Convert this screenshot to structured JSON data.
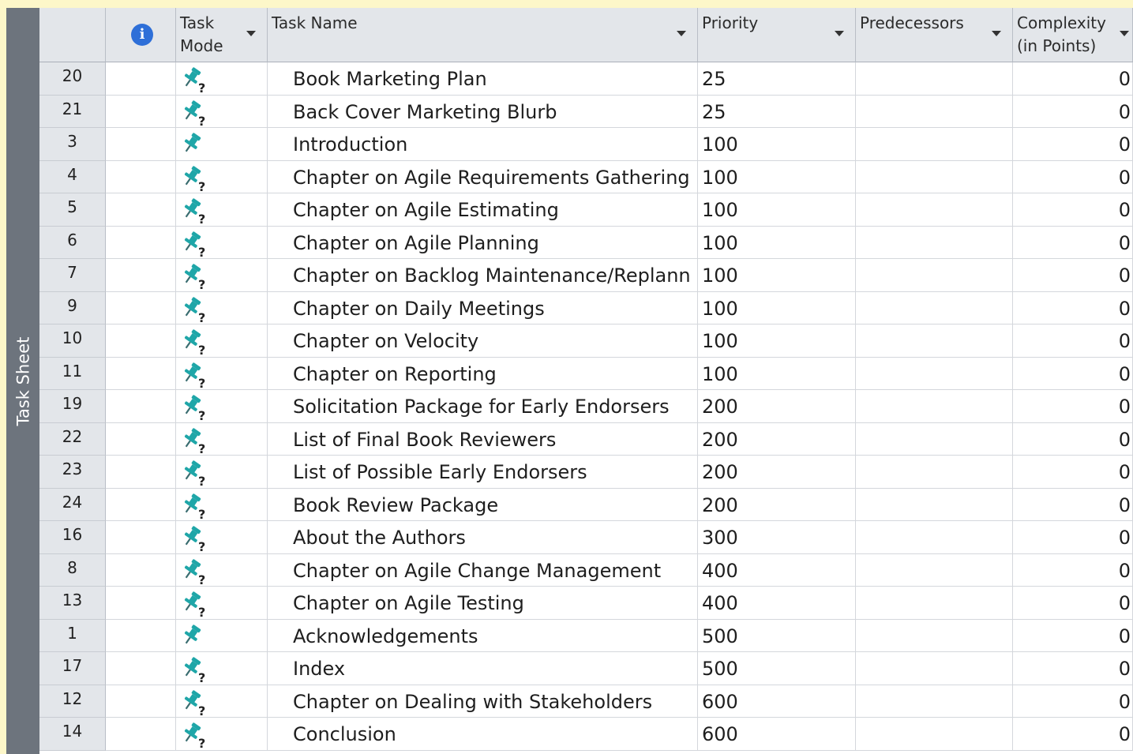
{
  "sidebar": {
    "label": "Task Sheet"
  },
  "header": {
    "info_icon": "info-icon",
    "task_mode": "Task\nMode",
    "task_name": "Task Name",
    "priority": "Priority",
    "predecessors": "Predecessors",
    "complexity": "Complexity\n(in Points)"
  },
  "colors": {
    "pin": "#1fa6a8",
    "question": "#222222",
    "header_bg": "#e3e6ea",
    "sidebar_bg": "#6d747d",
    "frame_bg": "#fdf7c9"
  },
  "rows": [
    {
      "id": "20",
      "mode_icon": "manual-pin-question-icon",
      "manual_q": true,
      "name": "Book Marketing Plan",
      "priority": "25",
      "predecessors": "",
      "complexity": "0"
    },
    {
      "id": "21",
      "mode_icon": "manual-pin-question-icon",
      "manual_q": true,
      "name": "Back Cover Marketing Blurb",
      "priority": "25",
      "predecessors": "",
      "complexity": "0"
    },
    {
      "id": "3",
      "mode_icon": "manual-pin-icon",
      "manual_q": false,
      "name": "Introduction",
      "priority": "100",
      "predecessors": "",
      "complexity": "0"
    },
    {
      "id": "4",
      "mode_icon": "manual-pin-question-icon",
      "manual_q": true,
      "name": "Chapter on Agile Requirements Gathering",
      "priority": "100",
      "predecessors": "",
      "complexity": "0"
    },
    {
      "id": "5",
      "mode_icon": "manual-pin-question-icon",
      "manual_q": true,
      "name": "Chapter on Agile Estimating",
      "priority": "100",
      "predecessors": "",
      "complexity": "0"
    },
    {
      "id": "6",
      "mode_icon": "manual-pin-question-icon",
      "manual_q": true,
      "name": "Chapter on Agile Planning",
      "priority": "100",
      "predecessors": "",
      "complexity": "0"
    },
    {
      "id": "7",
      "mode_icon": "manual-pin-question-icon",
      "manual_q": true,
      "name": "Chapter on Backlog Maintenance/Replann",
      "priority": "100",
      "predecessors": "",
      "complexity": "0"
    },
    {
      "id": "9",
      "mode_icon": "manual-pin-question-icon",
      "manual_q": true,
      "name": "Chapter on Daily Meetings",
      "priority": "100",
      "predecessors": "",
      "complexity": "0"
    },
    {
      "id": "10",
      "mode_icon": "manual-pin-question-icon",
      "manual_q": true,
      "name": "Chapter on Velocity",
      "priority": "100",
      "predecessors": "",
      "complexity": "0"
    },
    {
      "id": "11",
      "mode_icon": "manual-pin-question-icon",
      "manual_q": true,
      "name": "Chapter on Reporting",
      "priority": "100",
      "predecessors": "",
      "complexity": "0"
    },
    {
      "id": "19",
      "mode_icon": "manual-pin-question-icon",
      "manual_q": true,
      "name": "Solicitation Package for Early Endorsers",
      "priority": "200",
      "predecessors": "",
      "complexity": "0"
    },
    {
      "id": "22",
      "mode_icon": "manual-pin-question-icon",
      "manual_q": true,
      "name": "List of Final Book Reviewers",
      "priority": "200",
      "predecessors": "",
      "complexity": "0"
    },
    {
      "id": "23",
      "mode_icon": "manual-pin-question-icon",
      "manual_q": true,
      "name": "List of Possible Early Endorsers",
      "priority": "200",
      "predecessors": "",
      "complexity": "0"
    },
    {
      "id": "24",
      "mode_icon": "manual-pin-question-icon",
      "manual_q": true,
      "name": "Book Review Package",
      "priority": "200",
      "predecessors": "",
      "complexity": "0"
    },
    {
      "id": "16",
      "mode_icon": "manual-pin-question-icon",
      "manual_q": true,
      "name": "About the Authors",
      "priority": "300",
      "predecessors": "",
      "complexity": "0"
    },
    {
      "id": "8",
      "mode_icon": "manual-pin-question-icon",
      "manual_q": true,
      "name": "Chapter on Agile Change Management",
      "priority": "400",
      "predecessors": "",
      "complexity": "0"
    },
    {
      "id": "13",
      "mode_icon": "manual-pin-question-icon",
      "manual_q": true,
      "name": "Chapter on Agile Testing",
      "priority": "400",
      "predecessors": "",
      "complexity": "0"
    },
    {
      "id": "1",
      "mode_icon": "manual-pin-icon",
      "manual_q": false,
      "name": "Acknowledgements",
      "priority": "500",
      "predecessors": "",
      "complexity": "0"
    },
    {
      "id": "17",
      "mode_icon": "manual-pin-question-icon",
      "manual_q": true,
      "name": "Index",
      "priority": "500",
      "predecessors": "",
      "complexity": "0"
    },
    {
      "id": "12",
      "mode_icon": "manual-pin-question-icon",
      "manual_q": true,
      "name": "Chapter on Dealing with Stakeholders",
      "priority": "600",
      "predecessors": "",
      "complexity": "0"
    },
    {
      "id": "14",
      "mode_icon": "manual-pin-question-icon",
      "manual_q": true,
      "name": "Conclusion",
      "priority": "600",
      "predecessors": "",
      "complexity": "0"
    }
  ]
}
